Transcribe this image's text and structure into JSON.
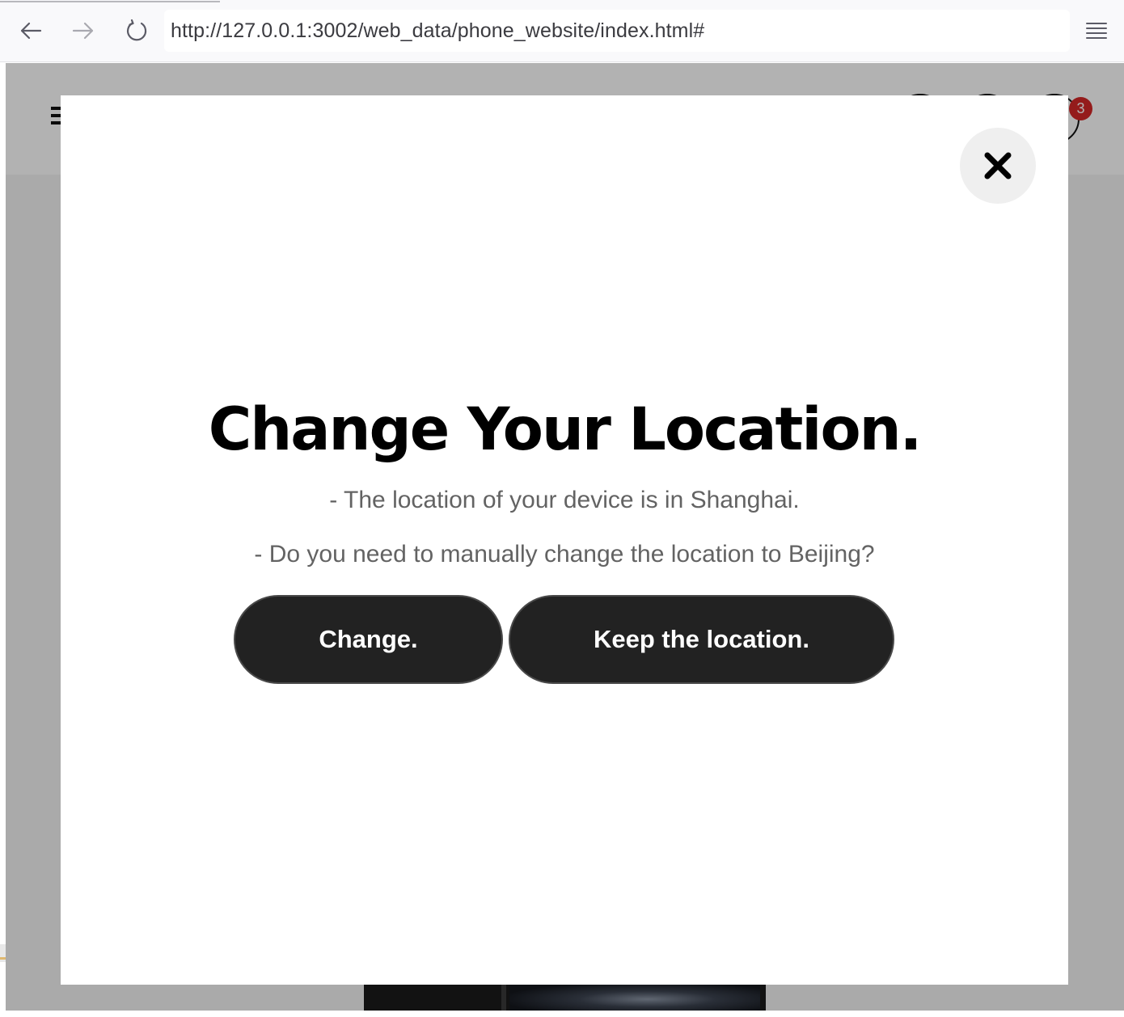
{
  "browser": {
    "url": "http://127.0.0.1:3002/web_data/phone_website/index.html#",
    "back_icon": "arrow-left-icon",
    "forward_icon": "arrow-right-icon",
    "reload_icon": "reload-icon",
    "menu_icon": "hamburger-menu-icon"
  },
  "site_header": {
    "cart_count": "3"
  },
  "modal": {
    "title": "Change Your Location.",
    "line_1": "- The location of your device is in Shanghai.",
    "line_2": "- Do you need to manually change the location to Beijing?",
    "change_button": "Change.",
    "keep_button": "Keep the location.",
    "close_icon": "close-icon"
  },
  "colors": {
    "button_bg": "#222222",
    "badge": "#d42828",
    "overlay": "rgba(0,0,0,0.30)"
  }
}
